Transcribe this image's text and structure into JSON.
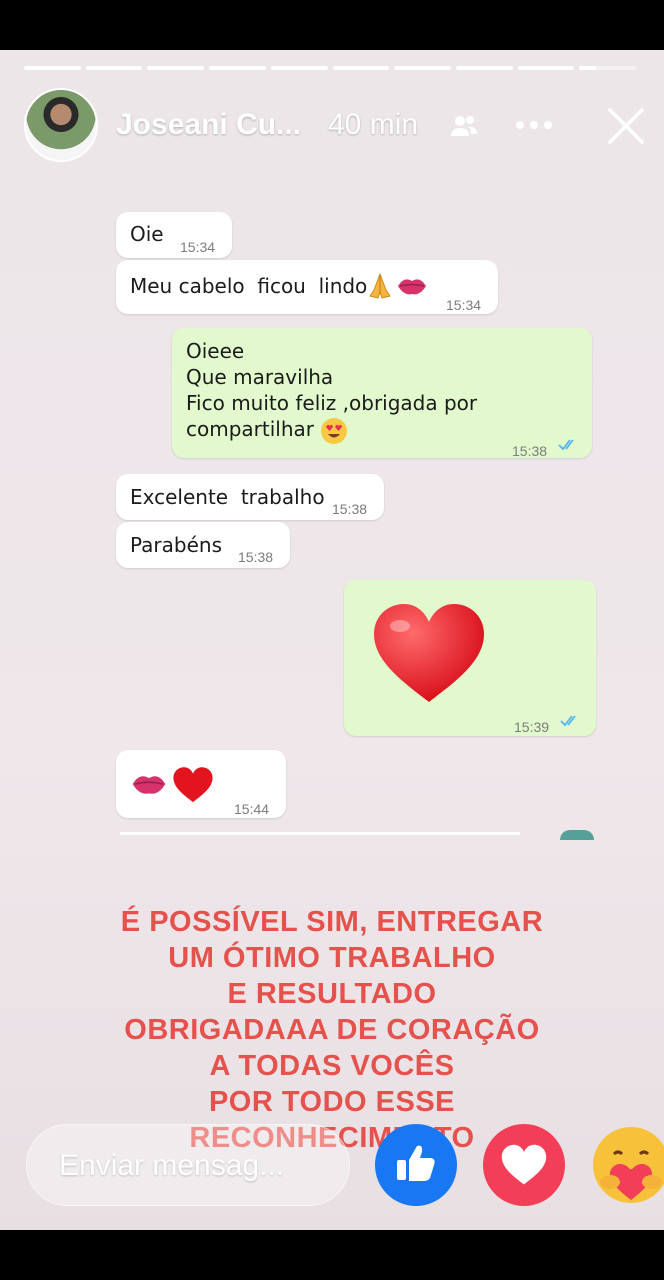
{
  "story": {
    "author_name": "Joseani Cu...",
    "time_ago": "40 min",
    "progress_segments": 10,
    "current_segment_fill": 0.3
  },
  "chat": {
    "messages": [
      {
        "text": "Oie",
        "time": "15:34",
        "direction": "in"
      },
      {
        "text": "Meu cabelo  ficou  lindo",
        "emoji": [
          "folded-hands",
          "kiss-lips"
        ],
        "time": "15:34",
        "direction": "in"
      },
      {
        "lines": [
          "Oieee",
          "Que maravilha",
          "Fico muito feliz ,obrigada por",
          "compartilhar"
        ],
        "emoji": [
          "heart-eyes"
        ],
        "time": "15:38",
        "direction": "out",
        "read": true
      },
      {
        "text": "Excelente  trabalho",
        "time": "15:38",
        "direction": "in"
      },
      {
        "text": "Parabéns",
        "time": "15:38",
        "direction": "in"
      },
      {
        "emoji": [
          "red-heart"
        ],
        "time": "15:39",
        "direction": "out",
        "read": true
      },
      {
        "emoji": [
          "kiss-lips",
          "red-heart"
        ],
        "time": "15:44",
        "direction": "in"
      }
    ]
  },
  "overlay_text": {
    "lines": [
      "É POSSÍVEL SIM, ENTREGAR",
      "UM ÓTIMO TRABALHO",
      "E RESULTADO",
      "OBRIGADAAA DE CORAÇÃO",
      "A TODAS VOCÊS",
      "POR TODO ESSE",
      "RECONHECIMENTO"
    ],
    "color": "#e5524e"
  },
  "reply": {
    "placeholder": "Enviar mensag..."
  },
  "reactions": [
    {
      "name": "like",
      "color": "#1877f2"
    },
    {
      "name": "love",
      "color": "#f33e58"
    },
    {
      "name": "care"
    }
  ]
}
